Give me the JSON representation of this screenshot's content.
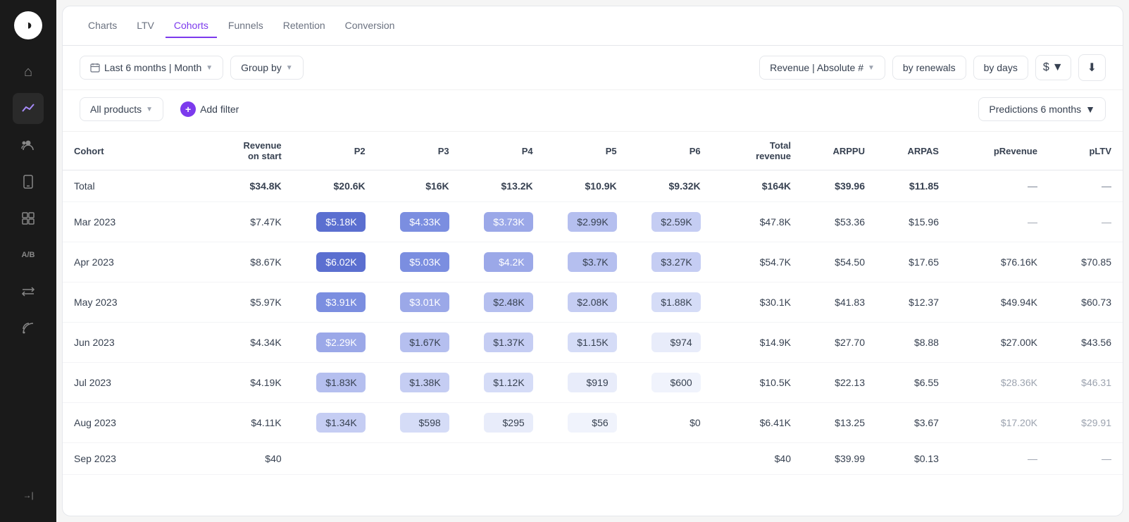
{
  "sidebar": {
    "logo": "◑",
    "icons": [
      {
        "name": "home-icon",
        "symbol": "⌂",
        "active": false
      },
      {
        "name": "chart-icon",
        "symbol": "↗",
        "active": true
      },
      {
        "name": "users-icon",
        "symbol": "👤",
        "active": false
      },
      {
        "name": "mobile-icon",
        "symbol": "▭",
        "active": false
      },
      {
        "name": "grid-icon",
        "symbol": "⊞",
        "active": false
      },
      {
        "name": "ab-icon",
        "symbol": "A/B",
        "active": false
      },
      {
        "name": "transfer-icon",
        "symbol": "⇄",
        "active": false
      },
      {
        "name": "rss-icon",
        "symbol": "◎",
        "active": false
      }
    ],
    "collapse_icon": "→|"
  },
  "nav": {
    "tabs": [
      {
        "label": "Charts",
        "active": false
      },
      {
        "label": "LTV",
        "active": false
      },
      {
        "label": "Cohorts",
        "active": true
      },
      {
        "label": "Funnels",
        "active": false
      },
      {
        "label": "Retention",
        "active": false
      },
      {
        "label": "Conversion",
        "active": false
      }
    ]
  },
  "toolbar": {
    "date_filter": "Last 6 months | Month",
    "group_by": "Group by",
    "revenue_filter": "Revenue | Absolute #",
    "by_renewals": "by renewals",
    "by_days": "by days",
    "download_icon": "⬇",
    "dollar_icon": "$"
  },
  "filter_row": {
    "all_products": "All products",
    "add_filter": "Add filter",
    "predictions": "Predictions 6 months"
  },
  "table": {
    "headers": [
      {
        "label": "Cohort",
        "key": "cohort"
      },
      {
        "label": "Revenue\non start",
        "key": "revenue_start"
      },
      {
        "label": "P2",
        "key": "p2"
      },
      {
        "label": "P3",
        "key": "p3"
      },
      {
        "label": "P4",
        "key": "p4"
      },
      {
        "label": "P5",
        "key": "p5"
      },
      {
        "label": "P6",
        "key": "p6"
      },
      {
        "label": "Total\nrevenue",
        "key": "total_revenue"
      },
      {
        "label": "ARPPU",
        "key": "arppu"
      },
      {
        "label": "ARPAS",
        "key": "arpas"
      },
      {
        "label": "pRevenue",
        "key": "prevenue"
      },
      {
        "label": "pLTV",
        "key": "pltv"
      }
    ],
    "rows": [
      {
        "cohort": "Total",
        "is_total": true,
        "revenue_start": "$34.8K",
        "p2": "$20.6K",
        "p3": "$16K",
        "p4": "$13.2K",
        "p5": "$10.9K",
        "p6": "$9.32K",
        "total_revenue": "$164K",
        "arppu": "$39.96",
        "arpas": "$11.85",
        "prevenue": "—",
        "pltv": "—"
      },
      {
        "cohort": "Mar 2023",
        "revenue_start": "$7.47K",
        "p2": "$5.18K",
        "p3": "$4.33K",
        "p4": "$3.73K",
        "p5": "$2.99K",
        "p6": "$2.59K",
        "total_revenue": "$47.8K",
        "arppu": "$53.36",
        "arpas": "$15.96",
        "prevenue": "—",
        "pltv": "—"
      },
      {
        "cohort": "Apr 2023",
        "revenue_start": "$8.67K",
        "p2": "$6.02K",
        "p3": "$5.03K",
        "p4": "$4.2K",
        "p5": "$3.7K",
        "p6": "$3.27K",
        "total_revenue": "$54.7K",
        "arppu": "$54.50",
        "arpas": "$17.65",
        "prevenue": "$76.16K",
        "pltv": "$70.85"
      },
      {
        "cohort": "May 2023",
        "revenue_start": "$5.97K",
        "p2": "$3.91K",
        "p3": "$3.01K",
        "p4": "$2.48K",
        "p5": "$2.08K",
        "p6": "$1.88K",
        "total_revenue": "$30.1K",
        "arppu": "$41.83",
        "arpas": "$12.37",
        "prevenue": "$49.94K",
        "pltv": "$60.73"
      },
      {
        "cohort": "Jun 2023",
        "revenue_start": "$4.34K",
        "p2": "$2.29K",
        "p3": "$1.67K",
        "p4": "$1.37K",
        "p5": "$1.15K",
        "p6": "$974",
        "total_revenue": "$14.9K",
        "arppu": "$27.70",
        "arpas": "$8.88",
        "prevenue": "$27.00K",
        "pltv": "$43.56"
      },
      {
        "cohort": "Jul 2023",
        "revenue_start": "$4.19K",
        "p2": "$1.83K",
        "p3": "$1.38K",
        "p4": "$1.12K",
        "p5": "$919",
        "p6": "$600",
        "total_revenue": "$10.5K",
        "arppu": "$22.13",
        "arpas": "$6.55",
        "prevenue": "$28.36K",
        "pltv": "$46.31",
        "prediction": true
      },
      {
        "cohort": "Aug 2023",
        "revenue_start": "$4.11K",
        "p2": "$1.34K",
        "p3": "$598",
        "p4": "$295",
        "p5": "$56",
        "p6": "$0",
        "total_revenue": "$6.41K",
        "arppu": "$13.25",
        "arpas": "$3.67",
        "prevenue": "$17.20K",
        "pltv": "$29.91",
        "prediction": true
      },
      {
        "cohort": "Sep 2023",
        "revenue_start": "$40",
        "p2": "",
        "p3": "",
        "p4": "",
        "p5": "",
        "p6": "",
        "total_revenue": "$40",
        "arppu": "$39.99",
        "arpas": "$0.13",
        "prevenue": "—",
        "pltv": "—"
      }
    ]
  }
}
